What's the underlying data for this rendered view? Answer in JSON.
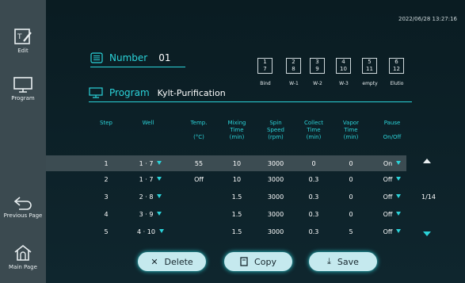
{
  "sidebar": {
    "edit_label": "Edit",
    "program_label": "Program",
    "previous_label": "Previous Page",
    "main_label": "Main Page"
  },
  "header": {
    "datetime": "2022/06/28 13:27:16"
  },
  "number_field": {
    "label": "Number",
    "value": "01"
  },
  "program_field": {
    "label": "Program",
    "value": "Kylt-Purification"
  },
  "wells": [
    {
      "top": "1",
      "bottom": "7",
      "label": "Bind"
    },
    {
      "top": "2",
      "bottom": "8",
      "label": "W-1"
    },
    {
      "top": "3",
      "bottom": "9",
      "label": "W-2"
    },
    {
      "top": "4",
      "bottom": "10",
      "label": "W-3"
    },
    {
      "top": "5",
      "bottom": "11",
      "label": "empty"
    },
    {
      "top": "6",
      "bottom": "12",
      "label": "Elutio"
    }
  ],
  "table": {
    "headers": [
      {
        "l1": "Step",
        "l2": "",
        "l3": ""
      },
      {
        "l1": "Well",
        "l2": "",
        "l3": ""
      },
      {
        "l1": "Temp.",
        "l2": "",
        "l3": "(°C)"
      },
      {
        "l1": "Mixing",
        "l2": "Time",
        "l3": "(min)"
      },
      {
        "l1": "Spin",
        "l2": "Speed",
        "l3": "(rpm)"
      },
      {
        "l1": "Collect",
        "l2": "Time",
        "l3": "(min)"
      },
      {
        "l1": "Vapor",
        "l2": "Time",
        "l3": "(min)"
      },
      {
        "l1": "Pause",
        "l2": "",
        "l3": "On/Off"
      }
    ],
    "rows": [
      {
        "step": "1",
        "well": "1 · 7",
        "temp": "55",
        "mix": "10",
        "speed": "3000",
        "collect": "0",
        "vapor": "0",
        "pause": "On"
      },
      {
        "step": "2",
        "well": "1 · 7",
        "temp": "Off",
        "mix": "10",
        "speed": "3000",
        "collect": "0.3",
        "vapor": "0",
        "pause": "Off"
      },
      {
        "step": "3",
        "well": "2 · 8",
        "temp": "",
        "mix": "1.5",
        "speed": "3000",
        "collect": "0.3",
        "vapor": "0",
        "pause": "Off"
      },
      {
        "step": "4",
        "well": "3 · 9",
        "temp": "",
        "mix": "1.5",
        "speed": "3000",
        "collect": "0.3",
        "vapor": "0",
        "pause": "Off"
      },
      {
        "step": "5",
        "well": "4 · 10",
        "temp": "",
        "mix": "1.5",
        "speed": "3000",
        "collect": "0.3",
        "vapor": "5",
        "pause": "Off"
      }
    ]
  },
  "pager": {
    "text": "1/14"
  },
  "buttons": {
    "delete": "Delete",
    "copy": "Copy",
    "save": "Save"
  },
  "colors": {
    "accent": "#2bd3d9",
    "sidebar": "#3b4a50",
    "background": "#0c1f26",
    "highlight_row": "#3c4c52",
    "button": "#c5e9ee"
  }
}
